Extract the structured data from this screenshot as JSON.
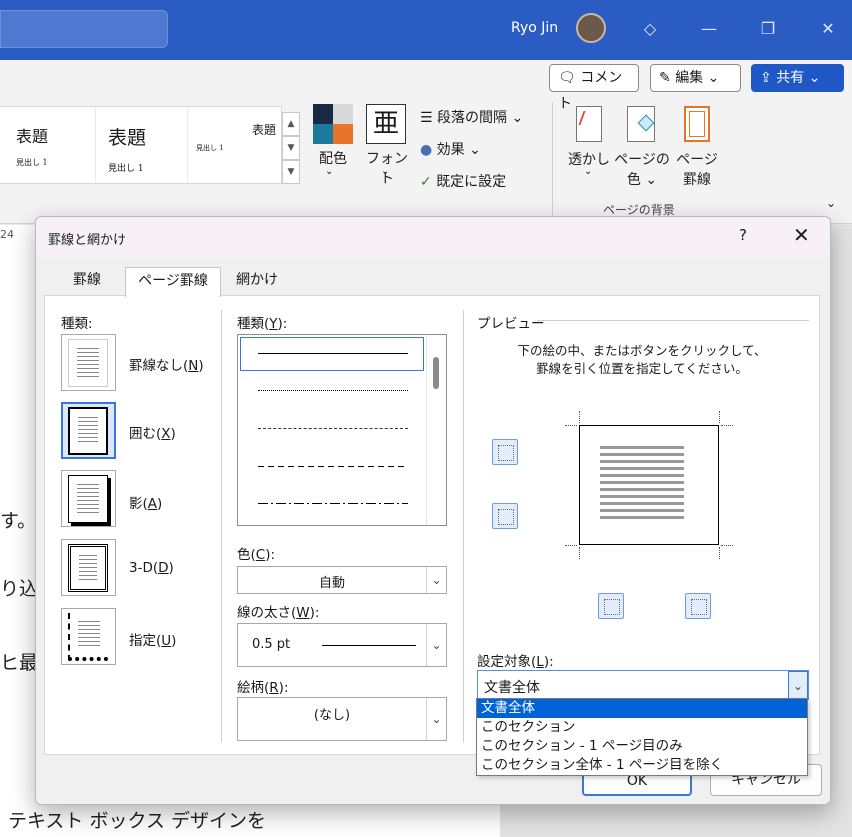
{
  "titlebar": {
    "user_name": "Ryo Jin"
  },
  "toolbar": {
    "comment_label": "コメント",
    "edit_label": "編集",
    "share_label": "共有"
  },
  "ribbon": {
    "styles": [
      "表題",
      "表題",
      "表題"
    ],
    "style_sub": [
      "見出し 1",
      "見出し 1",
      "見出し 1"
    ],
    "design_group": {
      "color_label": "配色",
      "font_label": "フォント",
      "paragraph_spacing": "段落の間隔",
      "effects": "効果",
      "set_default": "既定に設定"
    },
    "page_bg_group": {
      "watermark": "透かし",
      "page_color_1": "ページの",
      "page_color_2": "色",
      "page_border_1": "ページ",
      "page_border_2": "罫線",
      "group_label": "ページの背景"
    }
  },
  "document": {
    "ruler_num": "24",
    "lines": [
      "す。[",
      "り込み",
      "ヒ最適",
      "テキスト ボックス デザインを"
    ]
  },
  "dialog": {
    "title": "罫線と網かけ",
    "help": "?",
    "tabs": [
      "罫線",
      "ページ罫線",
      "網かけ"
    ],
    "setting": {
      "label": "種類:",
      "options": [
        {
          "text": "罫線なし",
          "key": "N"
        },
        {
          "text": "囲む",
          "key": "X"
        },
        {
          "text": "影",
          "key": "A"
        },
        {
          "text": "3-D",
          "key": "D"
        },
        {
          "text": "指定",
          "key": "U"
        }
      ]
    },
    "style": {
      "label": "種類",
      "key": "Y"
    },
    "color": {
      "label": "色",
      "key": "C",
      "value": "自動"
    },
    "width": {
      "label": "線の太さ",
      "key": "W",
      "value": "0.5 pt"
    },
    "art": {
      "label": "絵柄",
      "key": "R",
      "value": "(なし)"
    },
    "preview": {
      "label": "プレビュー",
      "instruction_1": "下の絵の中、またはボタンをクリックして、",
      "instruction_2": "罫線を引く位置を指定してください。"
    },
    "apply_to": {
      "label": "設定対象",
      "key": "L",
      "value": "文書全体",
      "options": [
        "文書全体",
        "このセクション",
        "このセクション - 1 ページ目のみ",
        "このセクション全体 - 1 ページ目を除く"
      ]
    },
    "ok_label": "OK",
    "cancel_label": "キャンセル"
  }
}
